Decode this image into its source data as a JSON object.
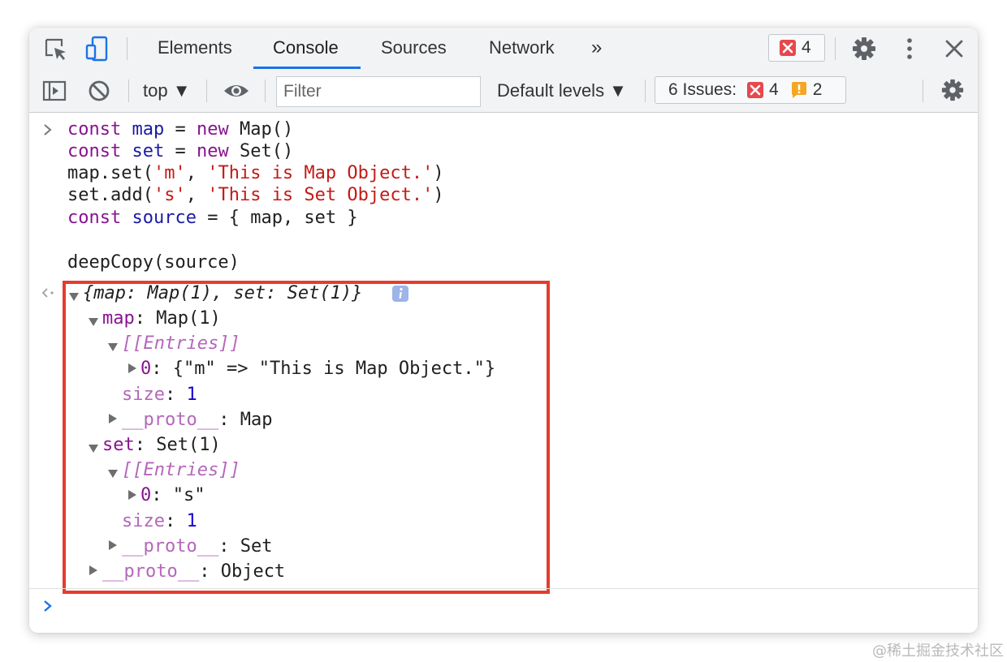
{
  "tabs": [
    {
      "label": "Elements"
    },
    {
      "label": "Console"
    },
    {
      "label": "Sources"
    },
    {
      "label": "Network"
    }
  ],
  "tabs_overflow": "»",
  "error_badge_count": "4",
  "toolbar": {
    "context": "top ▼",
    "filter_placeholder": "Filter",
    "levels": "Default levels ▼",
    "issues_label": "6 Issues:",
    "issues_errors": "4",
    "issues_warnings": "2"
  },
  "input_code": {
    "l1": {
      "kw": "const",
      "var": "map",
      "op": "=",
      "kw2": "new",
      "rest": "Map()"
    },
    "l2": {
      "kw": "const",
      "var": "set",
      "op": "=",
      "kw2": "new",
      "rest": "Set()"
    },
    "l3": {
      "pre": "map.set(",
      "s1": "'m'",
      "mid": ", ",
      "s2": "'This is Map Object.'",
      "post": ")"
    },
    "l4": {
      "pre": "set.add(",
      "s1": "'s'",
      "mid": ", ",
      "s2": "'This is Set Object.'",
      "post": ")"
    },
    "l5": {
      "kw": "const",
      "var": "source",
      "op": "=",
      "rest": "{ map, set }"
    },
    "l6": "deepCopy(source)"
  },
  "output": {
    "summary": "{map: Map(1), set: Set(1)}",
    "map_key": "map",
    "map_val": ": Map(1)",
    "entries": "[[Entries]]",
    "map_entry_key": "0",
    "map_entry_val": ": {\"m\" => \"This is Map Object.\"}",
    "size_key": "size",
    "size_colon": ": ",
    "size_val": "1",
    "proto_key": "__proto__",
    "map_proto_val": ": Map",
    "set_key": "set",
    "set_val": ": Set(1)",
    "set_entry_key": "0",
    "set_entry_val": ": \"s\"",
    "set_proto_val": ": Set",
    "obj_proto_val": ": Object"
  },
  "colors": {
    "accent": "#1a73e8",
    "highlight": "#e53c2e",
    "error": "#e5484d",
    "warning": "#f5a623"
  },
  "watermark": "@稀土掘金技术社区"
}
